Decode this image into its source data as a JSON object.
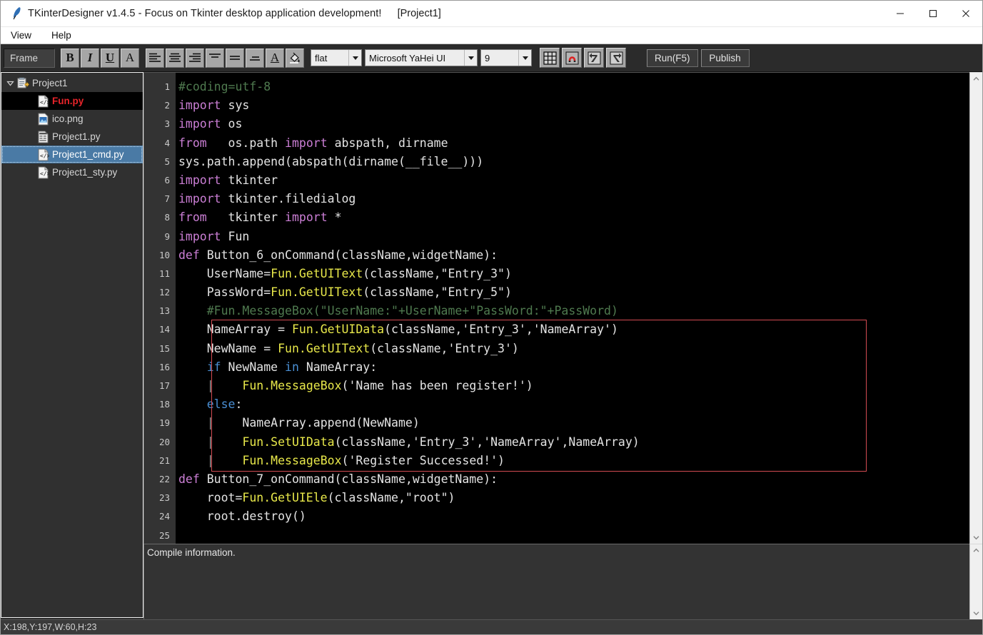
{
  "window": {
    "icon": "feather-icon",
    "title": "TKinterDesigner v1.4.5 - Focus on Tkinter desktop application development!",
    "project_tag": "[Project1]",
    "minimize_label": "—",
    "maximize_label": "□",
    "close_label": "✕"
  },
  "menubar": {
    "items": [
      {
        "label": "View"
      },
      {
        "label": "Help"
      }
    ]
  },
  "toolbar": {
    "widget_type": "Frame",
    "format_buttons": [
      {
        "name": "bold-button",
        "label": "B"
      },
      {
        "name": "italic-button",
        "label": "I"
      },
      {
        "name": "underline-button",
        "label": "U"
      },
      {
        "name": "font-style-button",
        "label": "A"
      }
    ],
    "align_buttons": [
      {
        "name": "align-left-button",
        "label": "align-left-icon"
      },
      {
        "name": "align-center-button",
        "label": "align-center-icon"
      },
      {
        "name": "align-right-button",
        "label": "align-right-icon"
      },
      {
        "name": "align-top-button",
        "label": "align-top-icon"
      },
      {
        "name": "align-middle-button",
        "label": "align-middle-icon"
      },
      {
        "name": "align-bottom-button",
        "label": "align-bottom-icon"
      },
      {
        "name": "text-color-button",
        "label": "A"
      },
      {
        "name": "fill-color-button",
        "label": "paint-bucket-icon"
      }
    ],
    "relief": {
      "value": "flat"
    },
    "font_family": {
      "value": "Microsoft YaHei UI"
    },
    "font_size": {
      "value": "9"
    },
    "tool_icons": [
      {
        "name": "grid-button",
        "label": "grid-icon"
      },
      {
        "name": "snap-magnet-button",
        "label": "magnet-icon"
      },
      {
        "name": "undo-button",
        "label": "undo-icon"
      },
      {
        "name": "redo-button",
        "label": "redo-icon"
      }
    ],
    "run_label": "Run(F5)",
    "publish_label": "Publish"
  },
  "project_tree": {
    "root": {
      "label": "Project1",
      "icon": "project-icon",
      "expanded": true
    },
    "items": [
      {
        "label": "Fun.py",
        "icon": "code-file-icon",
        "state": "active",
        "color": "#e8242a"
      },
      {
        "label": "ico.png",
        "icon": "image-file-icon",
        "state": "normal",
        "color": "#d6d6d6"
      },
      {
        "label": "Project1.py",
        "icon": "form-file-icon",
        "state": "normal",
        "color": "#d6d6d6"
      },
      {
        "label": "Project1_cmd.py",
        "icon": "code-file-icon",
        "state": "selected",
        "color": "#ffffff"
      },
      {
        "label": "Project1_sty.py",
        "icon": "code-file-icon",
        "state": "normal",
        "color": "#d6d6d6"
      }
    ]
  },
  "editor": {
    "line_numbers": [
      "1",
      "2",
      "3",
      "4",
      "5",
      "6",
      "7",
      "8",
      "9",
      "10",
      "11",
      "12",
      "13",
      "14",
      "15",
      "16",
      "17",
      "18",
      "19",
      "20",
      "21",
      "22",
      "23",
      "24",
      "25"
    ],
    "highlight_box": {
      "from_line": 14,
      "to_line": 21,
      "color": "#d24b52"
    },
    "lines": [
      {
        "n": 1,
        "text": "#coding=utf-8"
      },
      {
        "n": 2,
        "text": "import sys"
      },
      {
        "n": 3,
        "text": "import os"
      },
      {
        "n": 4,
        "text": "from   os.path import abspath, dirname"
      },
      {
        "n": 5,
        "text": "sys.path.append(abspath(dirname(__file__)))"
      },
      {
        "n": 6,
        "text": "import tkinter"
      },
      {
        "n": 7,
        "text": "import tkinter.filedialog"
      },
      {
        "n": 8,
        "text": "from   tkinter import *"
      },
      {
        "n": 9,
        "text": "import Fun"
      },
      {
        "n": 10,
        "text": "def Button_6_onCommand(className,widgetName):"
      },
      {
        "n": 11,
        "text": "    UserName=Fun.GetUIText(className,\"Entry_3\")"
      },
      {
        "n": 12,
        "text": "    PassWord=Fun.GetUIText(className,\"Entry_5\")"
      },
      {
        "n": 13,
        "text": "    #Fun.MessageBox(\"UserName:\"+UserName+\"PassWord:\"+PassWord)"
      },
      {
        "n": 14,
        "text": "    NameArray = Fun.GetUIData(className,'Entry_3','NameArray')"
      },
      {
        "n": 15,
        "text": "    NewName = Fun.GetUIText(className,'Entry_3')"
      },
      {
        "n": 16,
        "text": "    if NewName in NameArray:"
      },
      {
        "n": 17,
        "text": "    |    Fun.MessageBox('Name has been register!')"
      },
      {
        "n": 18,
        "text": "    else:"
      },
      {
        "n": 19,
        "text": "    |    NameArray.append(NewName)"
      },
      {
        "n": 20,
        "text": "    |    Fun.SetUIData(className,'Entry_3','NameArray',NameArray)"
      },
      {
        "n": 21,
        "text": "    |    Fun.MessageBox('Register Successed!')"
      },
      {
        "n": 22,
        "text": "def Button_7_onCommand(className,widgetName):"
      },
      {
        "n": 23,
        "text": "    root=Fun.GetUIEle(className,\"root\")"
      },
      {
        "n": 24,
        "text": "    root.destroy()"
      },
      {
        "n": 25,
        "text": ""
      }
    ]
  },
  "compile_panel": {
    "text": "Compile information."
  },
  "statusbar": {
    "text": "X:198,Y:197,W:60,H:23"
  },
  "colors": {
    "accent_selected": "#4a7aa5",
    "error_red": "#e8242a",
    "highlight_box": "#d24b52",
    "editor_bg": "#000000",
    "gutter_bg": "#333333",
    "chrome_bg": "#2b2b2b"
  }
}
